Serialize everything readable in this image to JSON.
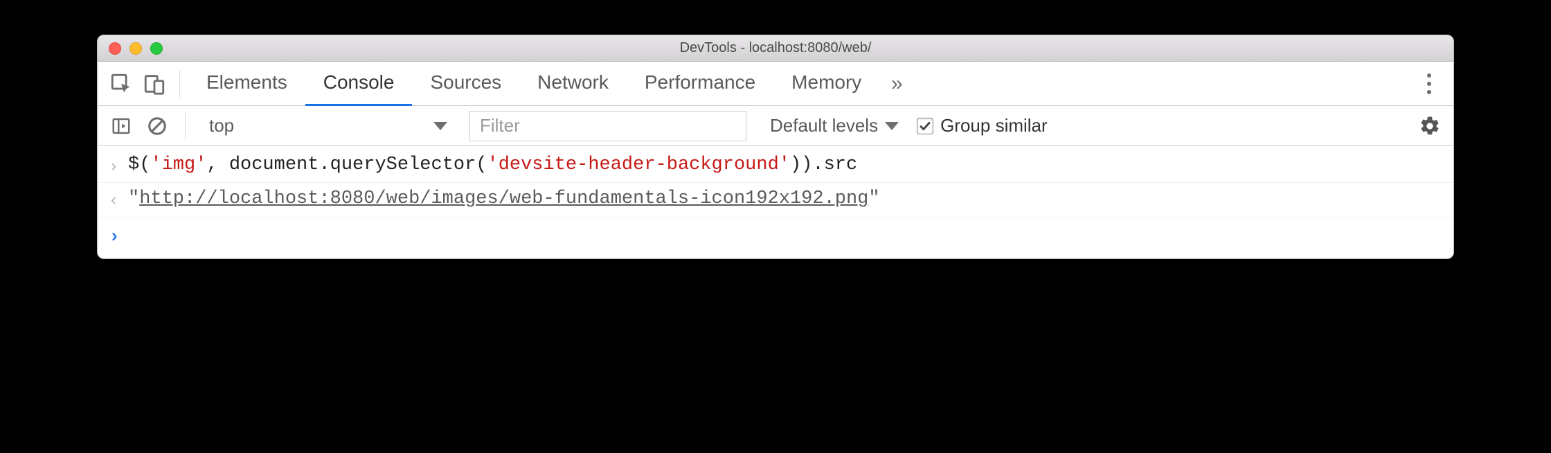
{
  "window": {
    "title": "DevTools - localhost:8080/web/"
  },
  "tabs": {
    "elements": "Elements",
    "console": "Console",
    "sources": "Sources",
    "network": "Network",
    "performance": "Performance",
    "memory": "Memory",
    "active": "console"
  },
  "toolbar": {
    "context": "top",
    "filter_placeholder": "Filter",
    "levels_label": "Default levels",
    "group_similar_label": "Group similar",
    "group_similar_checked": true
  },
  "console": {
    "input": {
      "pre1": "$(",
      "s1": "'img'",
      "mid1": ", document.querySelector(",
      "s2": "'devsite-header-background'",
      "post1": ")).src"
    },
    "output": {
      "q1": "\"",
      "url": "http://localhost:8080/web/images/web-fundamentals-icon192x192.png",
      "q2": "\""
    }
  }
}
